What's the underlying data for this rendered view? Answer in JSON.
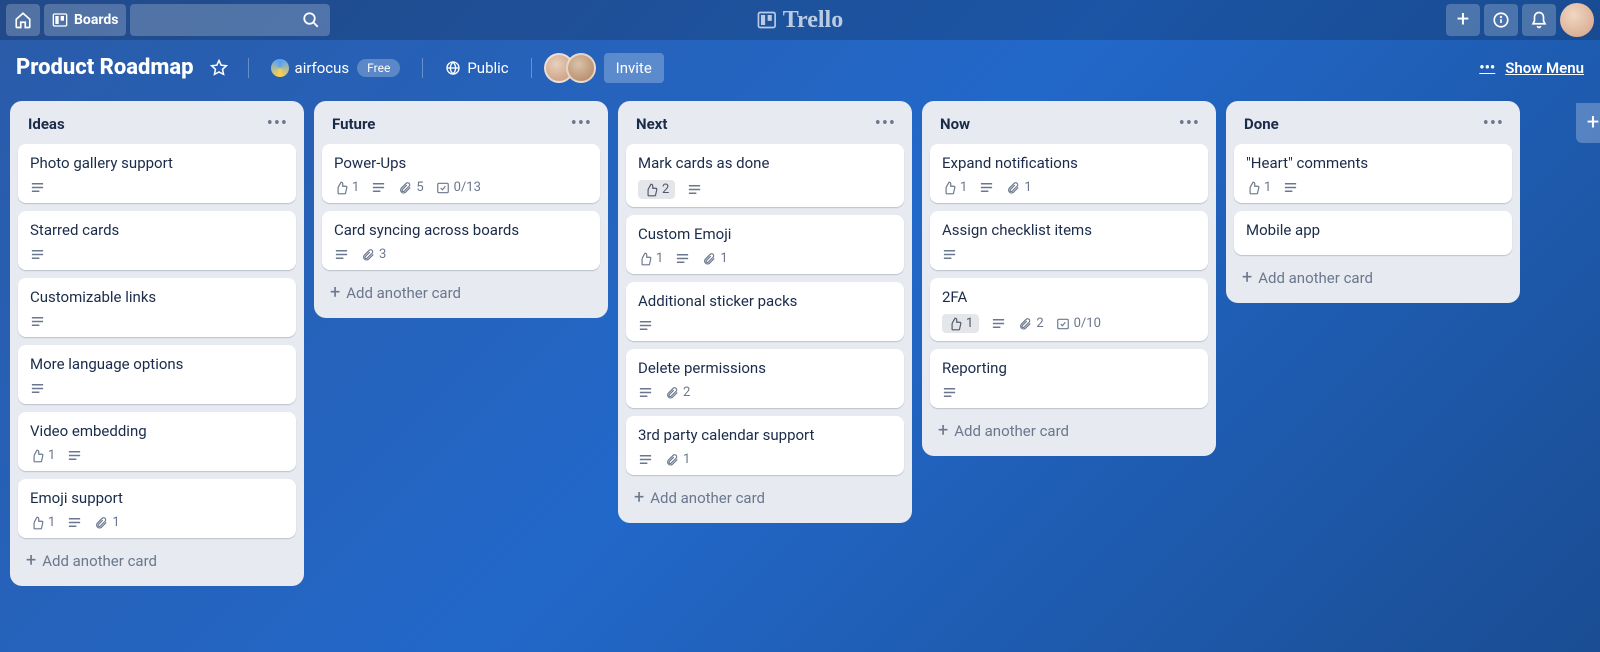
{
  "topbar": {
    "boards_label": "Boards",
    "logo_text": "Trello"
  },
  "board_header": {
    "title": "Product Roadmap",
    "team_name": "airfocus",
    "team_plan": "Free",
    "visibility": "Public",
    "invite_label": "Invite",
    "show_menu_label": "Show Menu"
  },
  "lists": [
    {
      "title": "Ideas",
      "cards": [
        {
          "title": "Photo gallery support",
          "badges": [
            {
              "type": "desc"
            }
          ]
        },
        {
          "title": "Starred cards",
          "badges": [
            {
              "type": "desc"
            }
          ]
        },
        {
          "title": "Customizable links",
          "badges": [
            {
              "type": "desc"
            }
          ]
        },
        {
          "title": "More language options",
          "badges": [
            {
              "type": "desc"
            }
          ]
        },
        {
          "title": "Video embedding",
          "badges": [
            {
              "type": "vote",
              "val": "1"
            },
            {
              "type": "desc"
            }
          ]
        },
        {
          "title": "Emoji support",
          "badges": [
            {
              "type": "vote",
              "val": "1"
            },
            {
              "type": "desc"
            },
            {
              "type": "attach",
              "val": "1"
            }
          ]
        }
      ],
      "add_label": "Add another card"
    },
    {
      "title": "Future",
      "cards": [
        {
          "title": "Power-Ups",
          "badges": [
            {
              "type": "vote",
              "val": "1"
            },
            {
              "type": "desc"
            },
            {
              "type": "attach",
              "val": "5"
            },
            {
              "type": "check",
              "val": "0/13"
            }
          ]
        },
        {
          "title": "Card syncing across boards",
          "badges": [
            {
              "type": "desc"
            },
            {
              "type": "attach",
              "val": "3"
            }
          ]
        }
      ],
      "add_label": "Add another card"
    },
    {
      "title": "Next",
      "cards": [
        {
          "title": "Mark cards as done",
          "badges": [
            {
              "type": "vote",
              "val": "2",
              "hi": true
            },
            {
              "type": "desc"
            }
          ]
        },
        {
          "title": "Custom Emoji",
          "badges": [
            {
              "type": "vote",
              "val": "1"
            },
            {
              "type": "desc"
            },
            {
              "type": "attach",
              "val": "1"
            }
          ]
        },
        {
          "title": "Additional sticker packs",
          "badges": [
            {
              "type": "desc"
            }
          ]
        },
        {
          "title": "Delete permissions",
          "badges": [
            {
              "type": "desc"
            },
            {
              "type": "attach",
              "val": "2"
            }
          ]
        },
        {
          "title": "3rd party calendar support",
          "badges": [
            {
              "type": "desc"
            },
            {
              "type": "attach",
              "val": "1"
            }
          ]
        }
      ],
      "add_label": "Add another card"
    },
    {
      "title": "Now",
      "cards": [
        {
          "title": "Expand notifications",
          "badges": [
            {
              "type": "vote",
              "val": "1"
            },
            {
              "type": "desc"
            },
            {
              "type": "attach",
              "val": "1"
            }
          ]
        },
        {
          "title": "Assign checklist items",
          "badges": [
            {
              "type": "desc"
            }
          ]
        },
        {
          "title": "2FA",
          "badges": [
            {
              "type": "vote",
              "val": "1",
              "hi": true
            },
            {
              "type": "desc"
            },
            {
              "type": "attach",
              "val": "2"
            },
            {
              "type": "check",
              "val": "0/10"
            }
          ]
        },
        {
          "title": "Reporting",
          "badges": [
            {
              "type": "desc"
            }
          ]
        }
      ],
      "add_label": "Add another card"
    },
    {
      "title": "Done",
      "cards": [
        {
          "title": "\"Heart\" comments",
          "badges": [
            {
              "type": "vote",
              "val": "1"
            },
            {
              "type": "desc"
            }
          ]
        },
        {
          "title": "Mobile app",
          "badges": []
        }
      ],
      "add_label": "Add another card"
    }
  ]
}
